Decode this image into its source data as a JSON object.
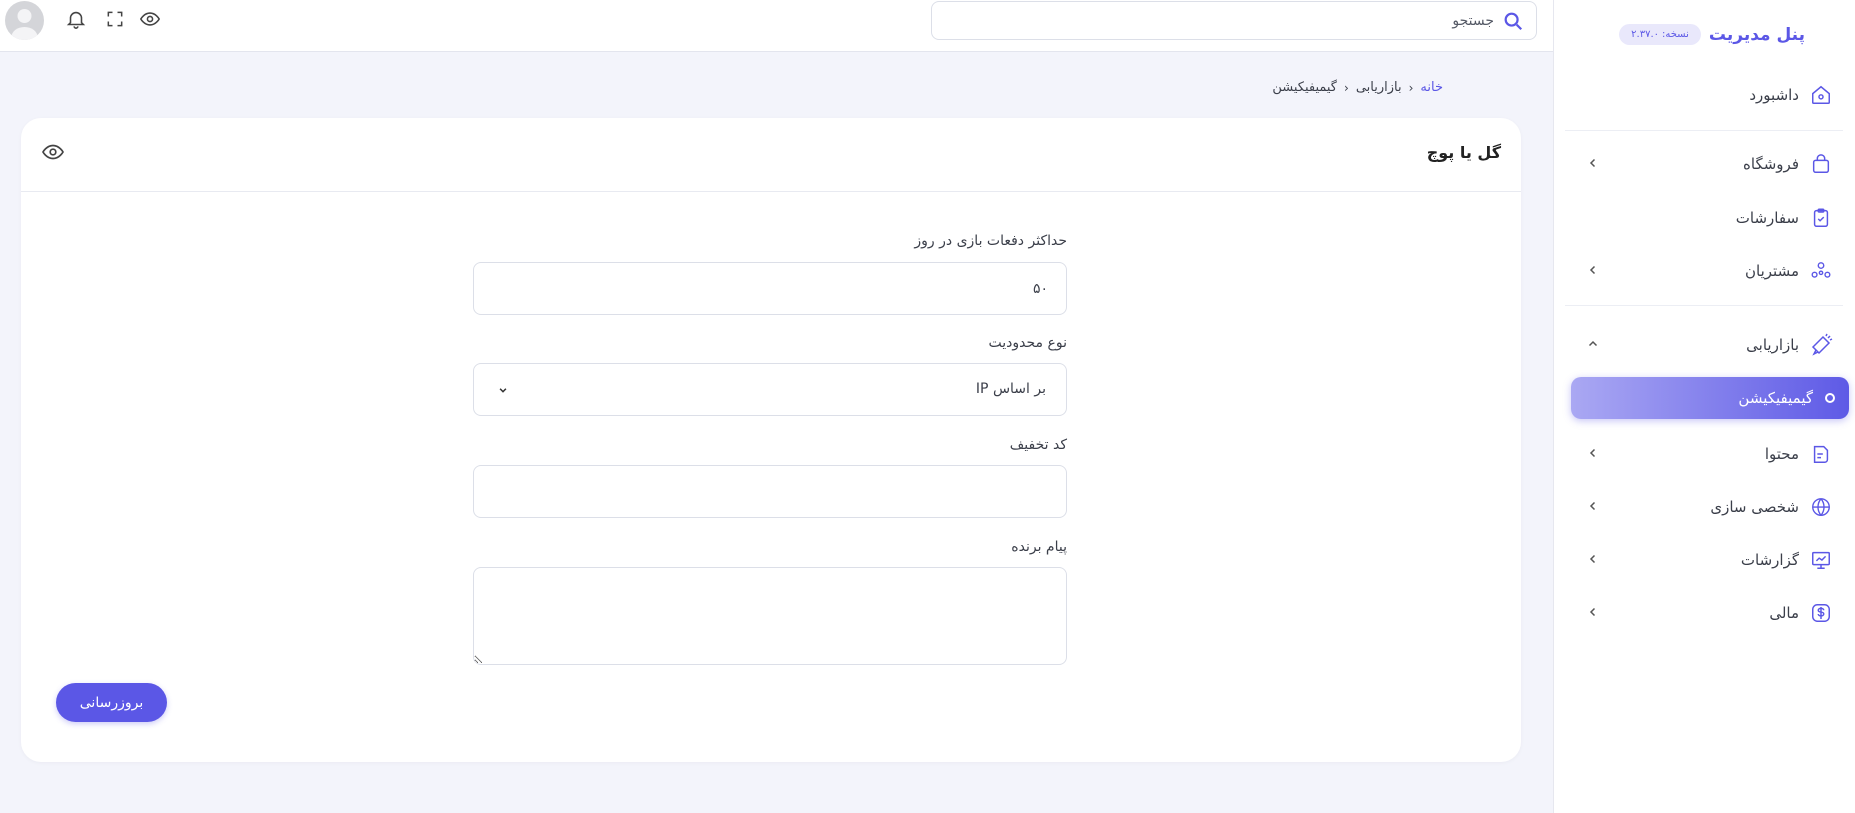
{
  "brand": {
    "title": "پنل مدیریت",
    "version_label": "نسخه:",
    "version": "۲.۳۷.۰"
  },
  "sidebar": {
    "items": [
      {
        "label": "داشبورد",
        "icon": "home-icon"
      },
      {
        "label": "فروشگاه",
        "icon": "bag-icon",
        "expandable": true
      },
      {
        "label": "سفارشات",
        "icon": "clipboard-check-icon"
      },
      {
        "label": "مشتریان",
        "icon": "users-icon",
        "expandable": true
      },
      {
        "label": "بازاریابی",
        "icon": "megaphone-icon",
        "expanded": true
      },
      {
        "label": "گیمیفیکیشن",
        "active": true
      },
      {
        "label": "محتوا",
        "icon": "document-icon",
        "expandable": true
      },
      {
        "label": "شخصی سازی",
        "icon": "globe-icon",
        "expandable": true
      },
      {
        "label": "گزارشات",
        "icon": "chart-board-icon",
        "expandable": true
      },
      {
        "label": "مالی",
        "icon": "dollar-icon",
        "expandable": true
      }
    ]
  },
  "topbar": {
    "search_placeholder": "جستجو"
  },
  "breadcrumb": {
    "home": "خانه",
    "section": "بازاریابی",
    "current": "گیمیفیکیشن"
  },
  "card": {
    "title": "گل یا پوچ"
  },
  "form": {
    "max_plays_label": "حداکثر دفعات بازی در روز",
    "max_plays_value": "۵۰",
    "restriction_label": "نوع محدودیت",
    "restriction_value": "بر اساس IP",
    "discount_label": "کد تخفیف",
    "discount_value": "",
    "winner_message_label": "پیام برنده",
    "winner_message_value": "",
    "submit_label": "بروزرسانی"
  },
  "colors": {
    "accent": "#5b57e6",
    "background": "#f3f4fb"
  }
}
